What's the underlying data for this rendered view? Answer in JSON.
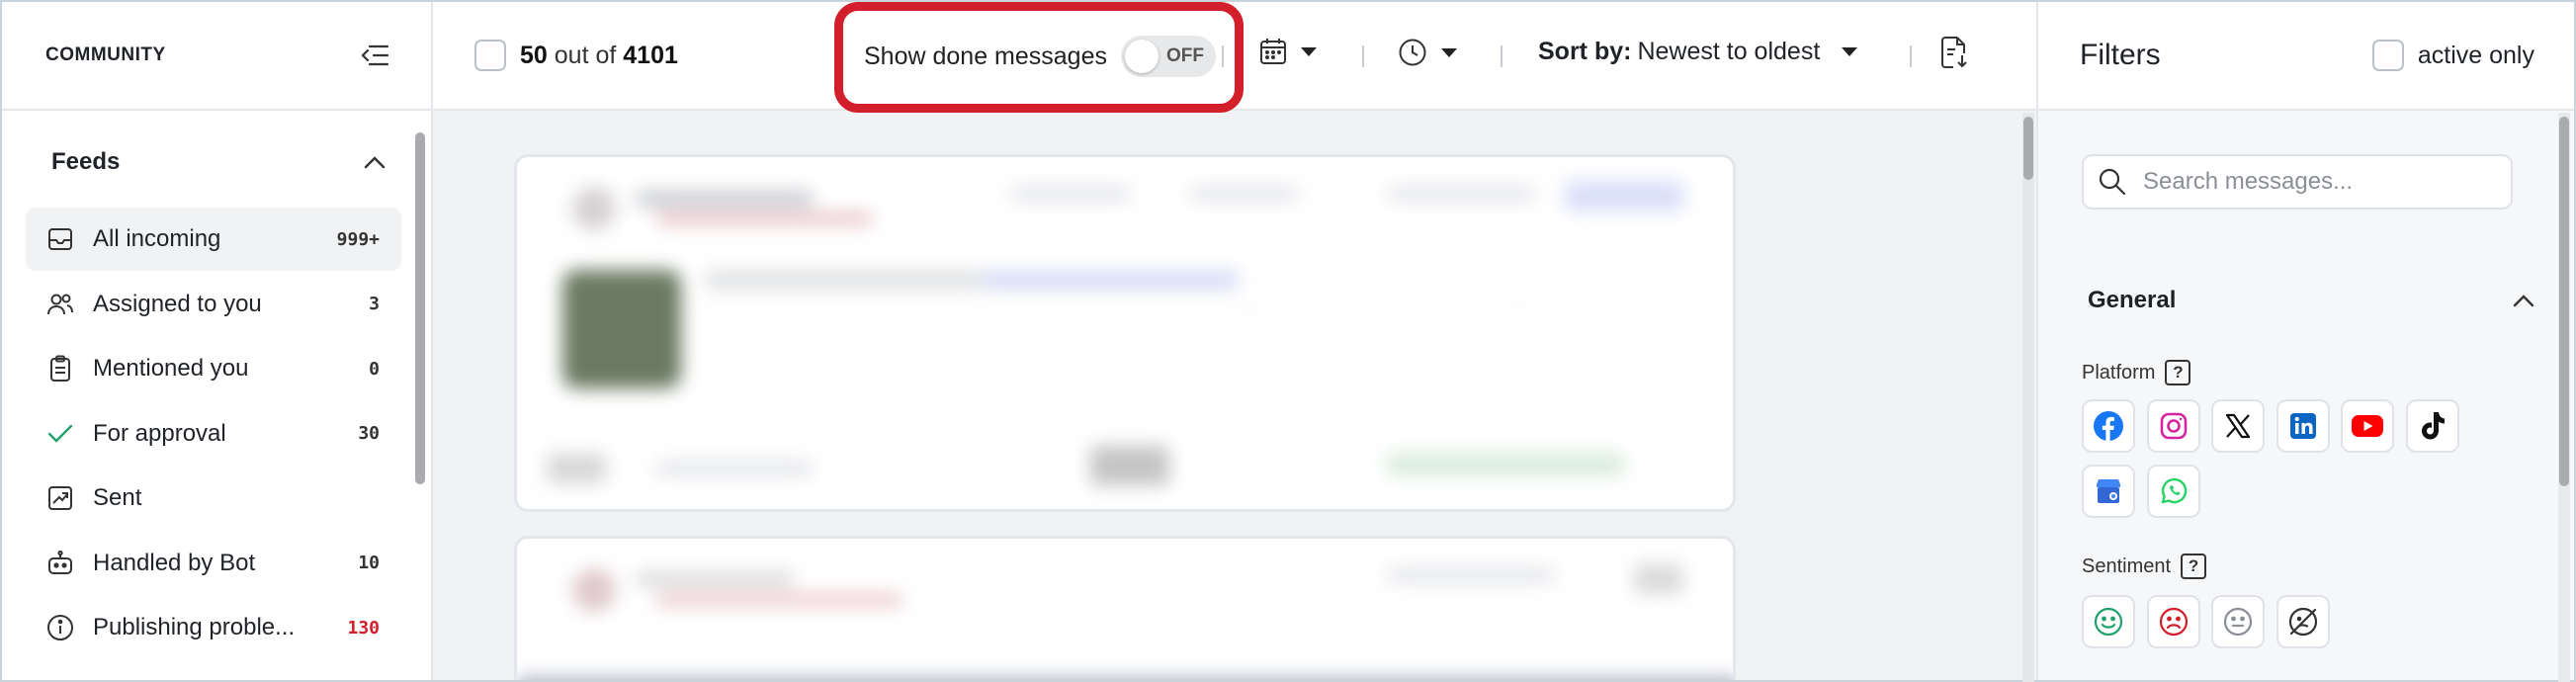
{
  "sidebar": {
    "brand": "COMMUNITY",
    "feeds_title": "Feeds",
    "items": [
      {
        "label": "All incoming",
        "count": "999+",
        "icon": "inbox-icon"
      },
      {
        "label": "Assigned to you",
        "count": "3",
        "icon": "users-icon"
      },
      {
        "label": "Mentioned you",
        "count": "0",
        "icon": "clipboard-icon"
      },
      {
        "label": "For approval",
        "count": "30",
        "icon": "check-icon"
      },
      {
        "label": "Sent",
        "count": "",
        "icon": "sent-icon"
      },
      {
        "label": "Handled by Bot",
        "count": "10",
        "icon": "bot-icon"
      },
      {
        "label": "Publishing proble...",
        "count": "130",
        "icon": "info-icon"
      }
    ]
  },
  "toolbar": {
    "shown": "50",
    "out_of": "out of",
    "total": "4101",
    "show_done_label": "Show done messages",
    "toggle_state": "OFF",
    "sort_prefix": "Sort by:",
    "sort_value": "Newest to oldest"
  },
  "filters": {
    "title": "Filters",
    "active_only": "active only",
    "search_placeholder": "Search messages...",
    "general_title": "General",
    "platform_label": "Platform",
    "sentiment_label": "Sentiment",
    "platforms": [
      "facebook-icon",
      "instagram-icon",
      "x-icon",
      "linkedin-icon",
      "youtube-icon",
      "tiktok-icon",
      "google-business-icon",
      "whatsapp-icon"
    ],
    "sentiments": [
      "positive-icon",
      "negative-icon",
      "neutral-icon",
      "no-sentiment-icon"
    ]
  },
  "colors": {
    "highlight": "#d21f2b",
    "count_alert": "#d21f2b",
    "check_green": "#22a06b"
  }
}
